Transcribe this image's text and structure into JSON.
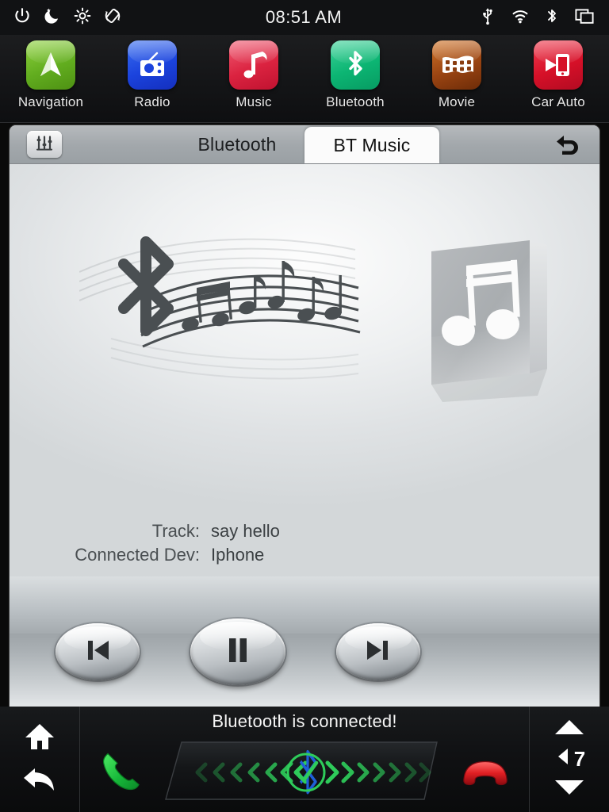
{
  "statusbar": {
    "clock": "08:51 AM",
    "left_icons": [
      "power-icon",
      "night-mode-icon",
      "brightness-icon",
      "screen-rotation-icon"
    ],
    "right_icons": [
      "usb-icon",
      "wifi-icon",
      "bluetooth-icon",
      "multi-window-icon"
    ]
  },
  "dock": {
    "apps": [
      {
        "label": "Navigation",
        "icon": "navigation-arrow-icon",
        "color": "#62ad1f"
      },
      {
        "label": "Radio",
        "icon": "radio-icon",
        "color": "#1b43dd"
      },
      {
        "label": "Music",
        "icon": "music-note-icon",
        "color": "#db2340"
      },
      {
        "label": "Bluetooth",
        "icon": "bluetooth-icon",
        "color": "#0cb573"
      },
      {
        "label": "Movie",
        "icon": "film-strip-icon",
        "color": "#9a4412"
      },
      {
        "label": "Car Auto",
        "icon": "car-auto-phone-icon",
        "color": "#d61028"
      }
    ]
  },
  "panel": {
    "eq_button": "equalizer-icon",
    "back_button": "return-arrow-icon",
    "tabs": [
      {
        "label": "Bluetooth",
        "active": false
      },
      {
        "label": "BT Music",
        "active": true
      }
    ],
    "artwork": {
      "bluetooth_music_art": "bluetooth-music-staff-art",
      "album_art": "album-art-placeholder-icon"
    },
    "metadata": [
      {
        "key": "Track:",
        "value": "say hello"
      },
      {
        "key": "Connected Dev:",
        "value": "Iphone"
      }
    ],
    "transport": [
      {
        "name": "previous-track-button",
        "icon": "skip-previous-icon"
      },
      {
        "name": "pause-button",
        "icon": "pause-icon"
      },
      {
        "name": "next-track-button",
        "icon": "skip-next-icon"
      }
    ],
    "corner_button": "minimize-corner-button"
  },
  "bottombar": {
    "home_button": "home-icon",
    "back_button": "back-arrow-icon",
    "status_message": "Bluetooth is connected!",
    "answer_call_button": "answer-call-icon",
    "end_call_button": "end-call-icon",
    "visualizer": {
      "badge": "bluetooth-connected-check-badge",
      "left_chevrons": 7,
      "right_chevrons": 7,
      "accent": "#2ecc5a"
    },
    "volume": {
      "level": "7",
      "up_button": "volume-up-icon",
      "down_button": "volume-down-icon",
      "speaker_icon": "speaker-icon"
    }
  }
}
